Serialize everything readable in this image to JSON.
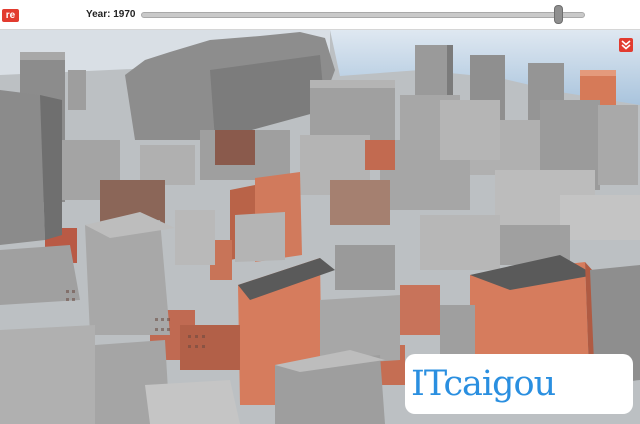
{
  "header": {
    "logo_text": "re",
    "year_label": "Year: 1970",
    "slider_position": 0.94
  },
  "controls": {
    "collapse_icon": "double-chevron-down-icon"
  },
  "watermark": {
    "text": "ITcaigou"
  },
  "colors": {
    "accent": "#e23b2f",
    "sky": "#a9c4dd",
    "building_gray": "#9c9c9c",
    "building_brick": "#d17a5c",
    "ground": "#bfc3c6",
    "watermark_text": "#2a8fe0"
  }
}
